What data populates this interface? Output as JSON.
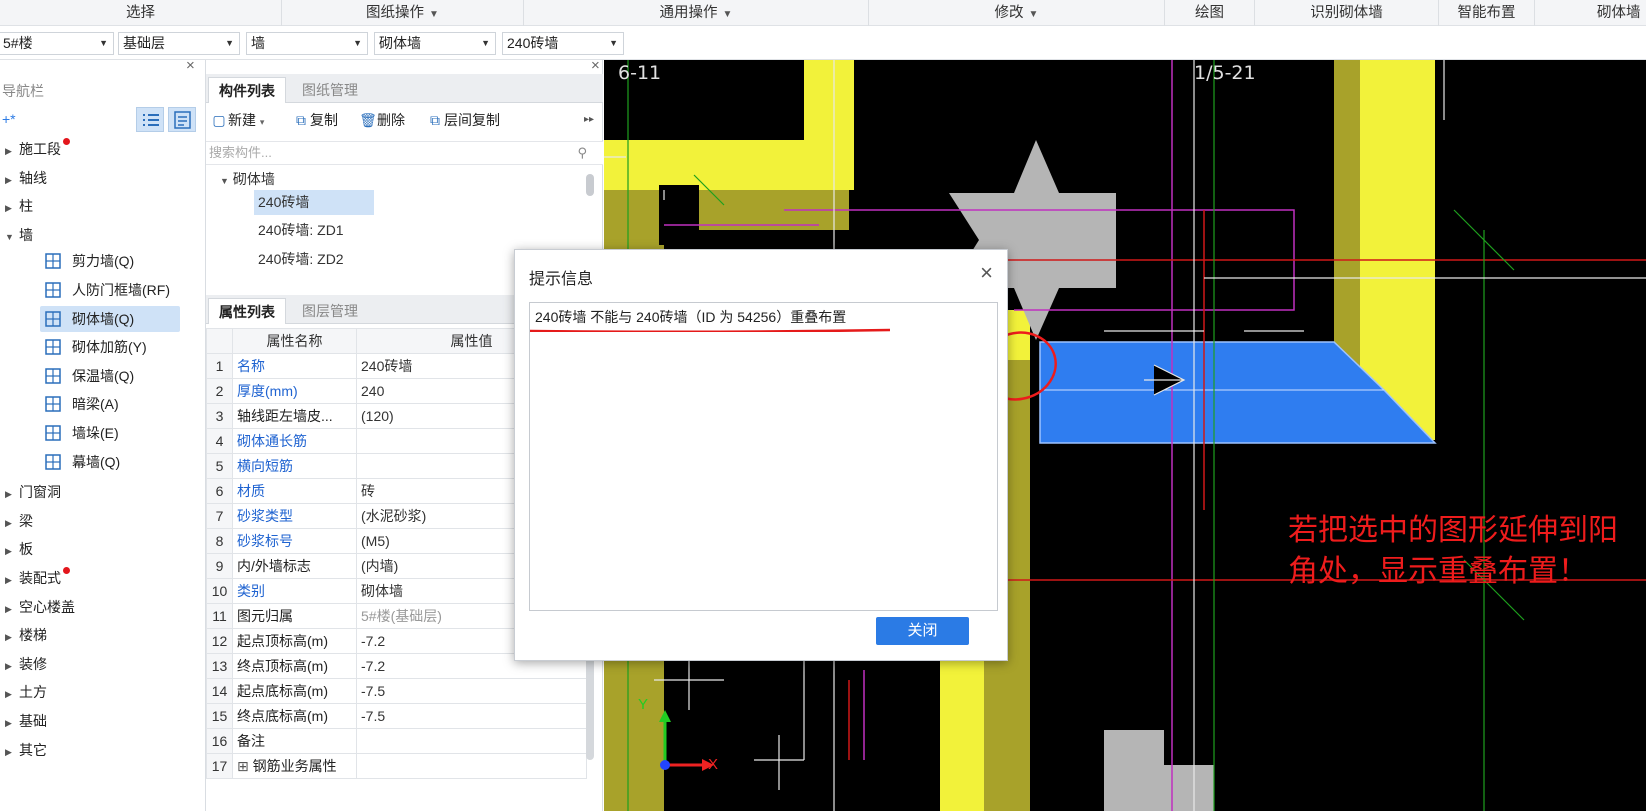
{
  "ribbon": {
    "groups": [
      {
        "label": "选择",
        "dropdown": false
      },
      {
        "label": "图纸操作",
        "dropdown": true
      },
      {
        "label": "通用操作",
        "dropdown": true
      },
      {
        "label": "修改",
        "dropdown": true
      },
      {
        "label": "绘图",
        "dropdown": false
      },
      {
        "label": "识别砌体墙",
        "dropdown": false
      },
      {
        "label": "智能布置",
        "dropdown": false
      },
      {
        "label": "砌体墙",
        "dropdown": false
      }
    ]
  },
  "filters": {
    "floor": "5#楼",
    "layer": "基础层",
    "category": "墙",
    "type": "砌体墙",
    "component": "240砖墙"
  },
  "nav": {
    "title": "导航栏",
    "tree": [
      {
        "label": "施工段",
        "expanded": false,
        "badge": true
      },
      {
        "label": "轴线",
        "expanded": false,
        "badge": false
      },
      {
        "label": "柱",
        "expanded": false,
        "badge": false
      },
      {
        "label": "墙",
        "expanded": true,
        "badge": false
      },
      {
        "label": "门窗洞",
        "expanded": false,
        "badge": false
      },
      {
        "label": "梁",
        "expanded": false,
        "badge": false
      },
      {
        "label": "板",
        "expanded": false,
        "badge": false
      },
      {
        "label": "装配式",
        "expanded": false,
        "badge": true
      },
      {
        "label": "空心楼盖",
        "expanded": false,
        "badge": false
      },
      {
        "label": "楼梯",
        "expanded": false,
        "badge": false
      },
      {
        "label": "装修",
        "expanded": false,
        "badge": false
      },
      {
        "label": "土方",
        "expanded": false,
        "badge": false
      },
      {
        "label": "基础",
        "expanded": false,
        "badge": false
      },
      {
        "label": "其它",
        "expanded": false,
        "badge": false
      }
    ],
    "wall_children": [
      {
        "label": "剪力墙(Q)",
        "icon": "shear-wall-icon",
        "selected": false
      },
      {
        "label": "人防门框墙(RF)",
        "icon": "civil-defense-door-frame-icon",
        "selected": false
      },
      {
        "label": "砌体墙(Q)",
        "icon": "masonry-wall-icon",
        "selected": true
      },
      {
        "label": "砌体加筋(Y)",
        "icon": "masonry-reinforcement-icon",
        "selected": false
      },
      {
        "label": "保温墙(Q)",
        "icon": "insulation-wall-icon",
        "selected": false
      },
      {
        "label": "暗梁(A)",
        "icon": "hidden-beam-icon",
        "selected": false
      },
      {
        "label": "墙垛(E)",
        "icon": "wall-buttress-icon",
        "selected": false
      },
      {
        "label": "幕墙(Q)",
        "icon": "curtain-wall-icon",
        "selected": false
      }
    ]
  },
  "component_panel": {
    "tabs": [
      "构件列表",
      "图纸管理"
    ],
    "active_tab": 0,
    "toolbar": {
      "new": "新建",
      "copy": "复制",
      "delete": "删除",
      "floor_copy": "层间复制"
    },
    "search_placeholder": "搜索构件...",
    "group": "砌体墙",
    "items": [
      "240砖墙",
      "240砖墙: ZD1",
      "240砖墙: ZD2"
    ],
    "selected_index": 0
  },
  "property_panel": {
    "tabs": [
      "属性列表",
      "图层管理"
    ],
    "active_tab": 0,
    "columns": [
      "属性名称",
      "属性值"
    ],
    "rows": [
      {
        "no": "1",
        "name": "名称",
        "value": "240砖墙",
        "blue": true,
        "grey": false
      },
      {
        "no": "2",
        "name": "厚度(mm)",
        "value": "240",
        "blue": true,
        "grey": false
      },
      {
        "no": "3",
        "name": "轴线距左墙皮...",
        "value": "(120)",
        "blue": false,
        "grey": false
      },
      {
        "no": "4",
        "name": "砌体通长筋",
        "value": "",
        "blue": true,
        "grey": false
      },
      {
        "no": "5",
        "name": "横向短筋",
        "value": "",
        "blue": true,
        "grey": false
      },
      {
        "no": "6",
        "name": "材质",
        "value": "砖",
        "blue": true,
        "grey": false
      },
      {
        "no": "7",
        "name": "砂浆类型",
        "value": "(水泥砂浆)",
        "blue": true,
        "grey": false
      },
      {
        "no": "8",
        "name": "砂浆标号",
        "value": "(M5)",
        "blue": true,
        "grey": false
      },
      {
        "no": "9",
        "name": "内/外墙标志",
        "value": "(内墙)",
        "blue": false,
        "grey": false
      },
      {
        "no": "10",
        "name": "类别",
        "value": "砌体墙",
        "blue": true,
        "grey": false
      },
      {
        "no": "11",
        "name": "图元归属",
        "value": "5#楼(基础层)",
        "blue": false,
        "grey": true
      },
      {
        "no": "12",
        "name": "起点顶标高(m)",
        "value": "-7.2",
        "blue": false,
        "grey": false
      },
      {
        "no": "13",
        "name": "终点顶标高(m)",
        "value": "-7.2",
        "blue": false,
        "grey": false
      },
      {
        "no": "14",
        "name": "起点底标高(m)",
        "value": "-7.5",
        "blue": false,
        "grey": false
      },
      {
        "no": "15",
        "name": "终点底标高(m)",
        "value": "-7.5",
        "blue": false,
        "grey": false
      },
      {
        "no": "16",
        "name": "备注",
        "value": "",
        "blue": false,
        "grey": false
      },
      {
        "no": "17",
        "name": "钢筋业务属性",
        "value": "",
        "blue": false,
        "grey": false,
        "expandable": true
      }
    ]
  },
  "canvas": {
    "axis_labels": [
      "6-11",
      "1/5-21"
    ],
    "coord_x": "X",
    "coord_y": "Y",
    "annotation": "若把选中的图形延伸到阳角处，显示重叠布置！",
    "colors": {
      "wall_yellow": "#f2f23a",
      "wall_olive": "#a8a22a",
      "selected_blue": "#2f7df0",
      "annotation_red": "#ee1c1c",
      "grey_shape": "#b5b5b5"
    }
  },
  "dialog": {
    "title": "提示信息",
    "message": "240砖墙 不能与 240砖墙（ID 为 54256）重叠布置",
    "ok_label": "关闭"
  }
}
